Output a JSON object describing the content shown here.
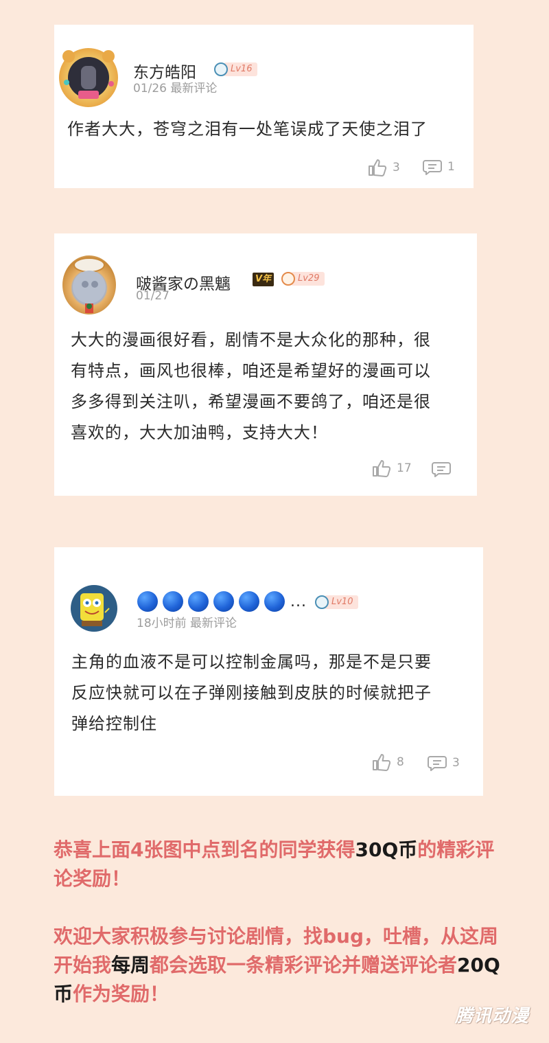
{
  "comments": [
    {
      "username": "东方皓阳",
      "level": "Lv16",
      "meta": "01/26 最新评论",
      "text": "作者大大，苍穹之泪有一处笔误成了天使之泪了",
      "likes": "3",
      "replies": "1",
      "avatar_icon": "teddy-bear-frame-avatar"
    },
    {
      "username": "啵酱家の黑魑",
      "level": "Lv29",
      "vip_badge": "V年",
      "meta": "01/27",
      "text_lines": [
        "大大的漫画很好看，剧情不是大众化的那种，很",
        "有特点，画风也很棒，咱还是希望好的漫画可以",
        "多多得到关注叭，希望漫画不要鸽了，咱还是很",
        "喜欢的，大大加油鸭，支持大大！"
      ],
      "likes": "17",
      "replies": "",
      "avatar_icon": "cat-frame-avatar"
    },
    {
      "username_ellipsis": "...",
      "level": "Lv10",
      "meta": "18小时前 最新评论",
      "text_lines": [
        "主角的血液不是可以控制金属吗，那是不是只要",
        "反应快就可以在子弹刚接触到皮肤的时候就把子",
        "弹给控制住"
      ],
      "likes": "8",
      "replies": "3",
      "avatar_icon": "spongebob-avatar"
    }
  ],
  "notice": {
    "para1_a": "恭喜上面4张图中点到名的同学获得",
    "para1_b": "30Q币",
    "para1_c": "的精彩评论奖励！",
    "para2_a": "欢迎大家积极参与讨论剧情，找bug，吐槽，从这周开始我",
    "para2_b": "每周",
    "para2_c": "都会选取一条精彩评论并赠送评论者",
    "para2_d": "20Q币",
    "para2_e": "作为奖励！"
  },
  "watermark": "腾讯动漫",
  "colors": {
    "background": "#fce9dc",
    "notice_red": "#e06a6a",
    "level_text": "#e07a66"
  }
}
